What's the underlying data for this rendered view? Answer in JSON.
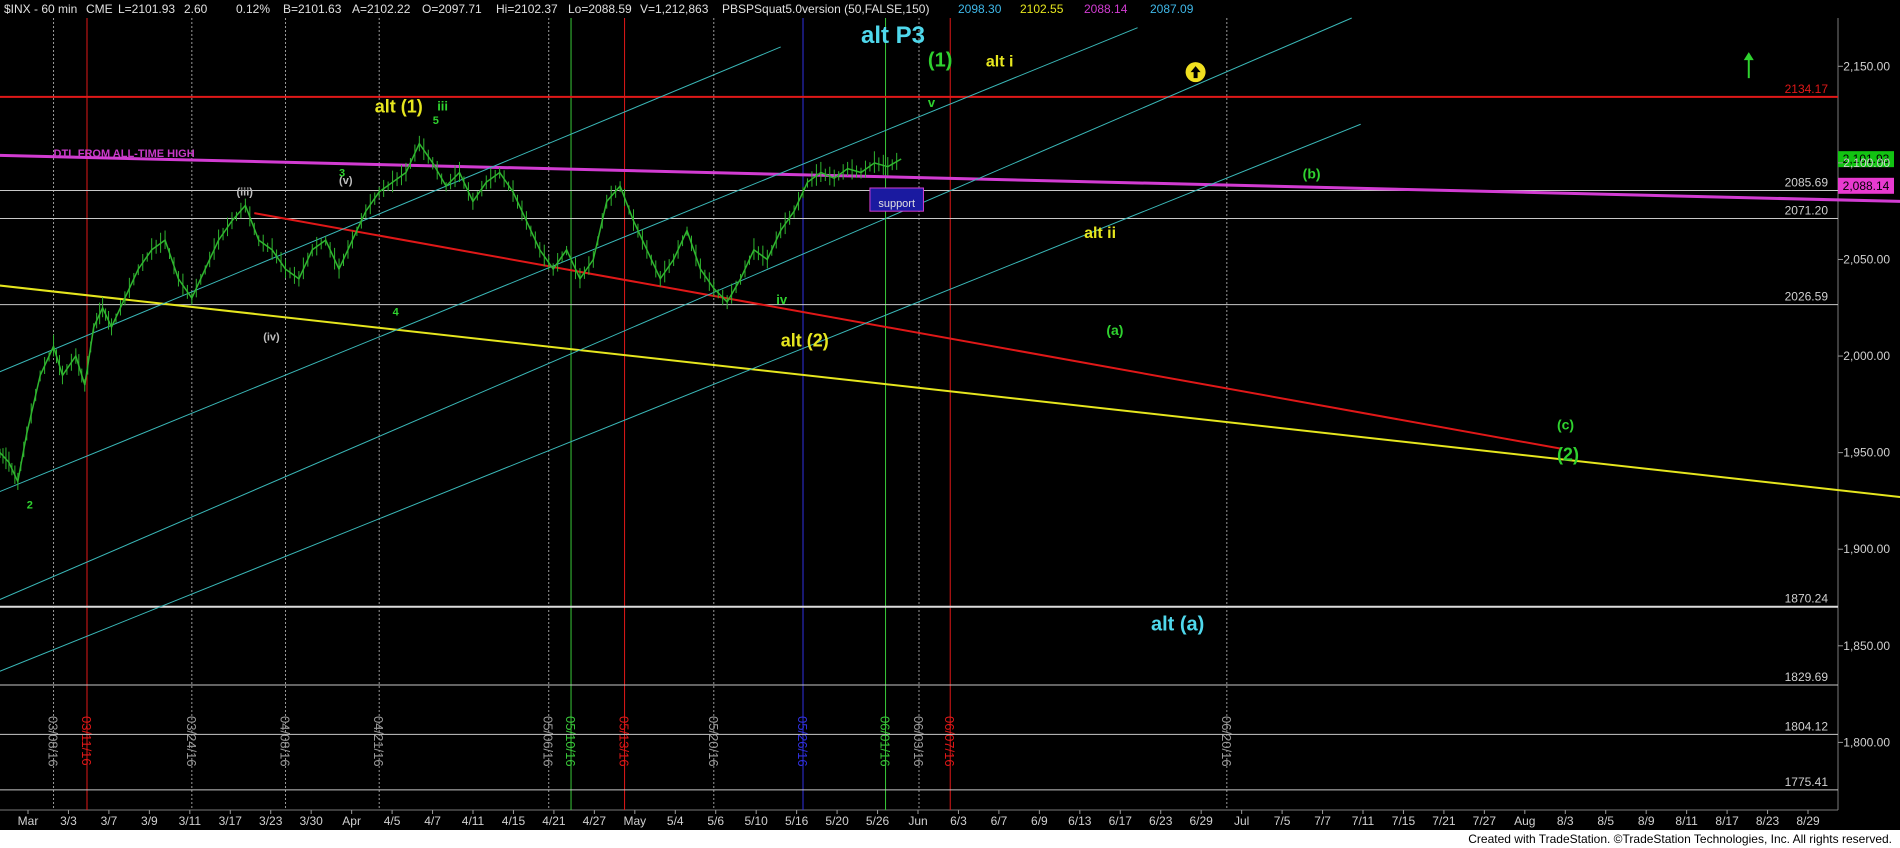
{
  "header": {
    "symbol": "$INX - 60 min",
    "exchange": "CME",
    "last": "L=2101.93",
    "change": "2.60",
    "pct": "0.12%",
    "bid": "B=2101.63",
    "ask": "A=2102.22",
    "open": "O=2097.71",
    "high": "Hi=2102.37",
    "low": "Lo=2088.59",
    "volume": "V=1,212,863",
    "indicator": "PBSPSquat5.0version (50,FALSE,150)",
    "ind_val1": "2098.30",
    "ind_val2": "2102.55",
    "ind_val3": "2088.14",
    "ind_val4": "2087.09"
  },
  "footer": {
    "credit": "Created with TradeStation. ©TradeStation Technologies, Inc. All rights reserved."
  },
  "chart_data": {
    "type": "line",
    "title": "",
    "ylim": [
      1765,
      2175
    ],
    "y_ticks": [
      "2,150.00",
      "2,100.00",
      "2,050.00",
      "2,000.00",
      "1,950.00",
      "1,900.00",
      "1,850.00",
      "1,800.00"
    ],
    "x_ticks": [
      "Mar",
      "3/3",
      "3/7",
      "3/9",
      "3/11",
      "3/17",
      "3/23",
      "3/30",
      "Apr",
      "4/5",
      "4/7",
      "4/11",
      "4/15",
      "4/21",
      "4/27",
      "May",
      "5/4",
      "5/6",
      "5/10",
      "5/16",
      "5/20",
      "5/26",
      "Jun",
      "6/3",
      "6/7",
      "6/9",
      "6/13",
      "6/17",
      "6/23",
      "6/29",
      "Jul",
      "7/5",
      "7/7",
      "7/11",
      "7/15",
      "7/21",
      "7/27",
      "Aug",
      "8/3",
      "8/5",
      "8/9",
      "8/11",
      "8/17",
      "8/23",
      "8/29"
    ],
    "price_series": [
      {
        "t": 0,
        "v": 1950
      },
      {
        "t": 2,
        "v": 1945
      },
      {
        "t": 4,
        "v": 1935
      },
      {
        "t": 6,
        "v": 1960
      },
      {
        "t": 9,
        "v": 1990
      },
      {
        "t": 12,
        "v": 2005
      },
      {
        "t": 14,
        "v": 1990
      },
      {
        "t": 17,
        "v": 2000
      },
      {
        "t": 19,
        "v": 1985
      },
      {
        "t": 21,
        "v": 2015
      },
      {
        "t": 23,
        "v": 2025
      },
      {
        "t": 25,
        "v": 2015
      },
      {
        "t": 28,
        "v": 2030
      },
      {
        "t": 31,
        "v": 2045
      },
      {
        "t": 34,
        "v": 2055
      },
      {
        "t": 37,
        "v": 2060
      },
      {
        "t": 40,
        "v": 2040
      },
      {
        "t": 43,
        "v": 2030
      },
      {
        "t": 46,
        "v": 2045
      },
      {
        "t": 49,
        "v": 2060
      },
      {
        "t": 52,
        "v": 2070
      },
      {
        "t": 55,
        "v": 2078
      },
      {
        "t": 58,
        "v": 2060
      },
      {
        "t": 61,
        "v": 2055
      },
      {
        "t": 64,
        "v": 2045
      },
      {
        "t": 67,
        "v": 2040
      },
      {
        "t": 70,
        "v": 2055
      },
      {
        "t": 73,
        "v": 2060
      },
      {
        "t": 76,
        "v": 2045
      },
      {
        "t": 79,
        "v": 2060
      },
      {
        "t": 82,
        "v": 2075
      },
      {
        "t": 85,
        "v": 2085
      },
      {
        "t": 88,
        "v": 2090
      },
      {
        "t": 91,
        "v": 2095
      },
      {
        "t": 94,
        "v": 2110
      },
      {
        "t": 97,
        "v": 2100
      },
      {
        "t": 100,
        "v": 2088
      },
      {
        "t": 103,
        "v": 2095
      },
      {
        "t": 106,
        "v": 2080
      },
      {
        "t": 109,
        "v": 2090
      },
      {
        "t": 112,
        "v": 2095
      },
      {
        "t": 115,
        "v": 2085
      },
      {
        "t": 118,
        "v": 2070
      },
      {
        "t": 121,
        "v": 2055
      },
      {
        "t": 124,
        "v": 2045
      },
      {
        "t": 127,
        "v": 2055
      },
      {
        "t": 130,
        "v": 2040
      },
      {
        "t": 133,
        "v": 2050
      },
      {
        "t": 136,
        "v": 2080
      },
      {
        "t": 139,
        "v": 2088
      },
      {
        "t": 142,
        "v": 2070
      },
      {
        "t": 145,
        "v": 2055
      },
      {
        "t": 148,
        "v": 2040
      },
      {
        "t": 151,
        "v": 2050
      },
      {
        "t": 154,
        "v": 2065
      },
      {
        "t": 157,
        "v": 2045
      },
      {
        "t": 160,
        "v": 2035
      },
      {
        "t": 163,
        "v": 2028
      },
      {
        "t": 166,
        "v": 2040
      },
      {
        "t": 169,
        "v": 2055
      },
      {
        "t": 172,
        "v": 2050
      },
      {
        "t": 175,
        "v": 2065
      },
      {
        "t": 178,
        "v": 2075
      },
      {
        "t": 181,
        "v": 2090
      },
      {
        "t": 184,
        "v": 2095
      },
      {
        "t": 187,
        "v": 2092
      },
      {
        "t": 190,
        "v": 2097
      },
      {
        "t": 193,
        "v": 2095
      },
      {
        "t": 196,
        "v": 2100
      },
      {
        "t": 199,
        "v": 2098
      },
      {
        "t": 202,
        "v": 2102
      }
    ],
    "price_color": "#2fb52f",
    "horizontal_levels": [
      {
        "v": 2134.17,
        "label": "2134.17",
        "color": "#e01818",
        "width": 2
      },
      {
        "v": 2085.69,
        "label": "2085.69",
        "color": "#c8c8c8",
        "width": 1
      },
      {
        "v": 2071.2,
        "label": "2071.20",
        "color": "#c8c8c8",
        "width": 1
      },
      {
        "v": 2026.59,
        "label": "2026.59",
        "color": "#c8c8c8",
        "width": 1
      },
      {
        "v": 1870.24,
        "label": "1870.24",
        "color": "#dcdcdc",
        "width": 2
      },
      {
        "v": 1829.69,
        "label": "1829.69",
        "color": "#c8c8c8",
        "width": 1
      },
      {
        "v": 1804.12,
        "label": "1804.12",
        "color": "#c8c8c8",
        "width": 1
      },
      {
        "v": 1775.41,
        "label": "1775.41",
        "color": "#c8c8c8",
        "width": 1
      }
    ],
    "price_flags": [
      {
        "v": 2101.93,
        "label": "2,101.93",
        "color": "#12c412"
      },
      {
        "v": 2088.14,
        "label": "2,088.14",
        "color": "#e83ad0"
      }
    ],
    "trend_lines": [
      {
        "name": "dtl",
        "color": "#d23cd2",
        "width": 3,
        "p1": [
          -2,
          2104
        ],
        "p2": [
          570,
          2072
        ]
      },
      {
        "name": "red",
        "color": "#e01818",
        "width": 2,
        "p1": [
          57,
          2074
        ],
        "p2": [
          350,
          1952
        ]
      },
      {
        "name": "yellow",
        "color": "#e6e61e",
        "width": 2,
        "p1": [
          -2,
          2037
        ],
        "p2": [
          430,
          1926
        ]
      },
      {
        "name": "ch1",
        "color": "#3ab8b8",
        "width": 1,
        "p1": [
          -2,
          1990
        ],
        "p2": [
          175,
          2160
        ]
      },
      {
        "name": "ch2",
        "color": "#3ab8b8",
        "width": 1,
        "p1": [
          -2,
          1928
        ],
        "p2": [
          255,
          2170
        ]
      },
      {
        "name": "ch3",
        "color": "#3ab8b8",
        "width": 1,
        "p1": [
          -2,
          1872
        ],
        "p2": [
          303,
          2175
        ]
      },
      {
        "name": "ch4",
        "color": "#3ab8b8",
        "width": 1,
        "p1": [
          -2,
          1835
        ],
        "p2": [
          305,
          2120
        ]
      }
    ],
    "vertical_markers": [
      {
        "t": 12,
        "label": "03/08/16",
        "color": "#9a9a9a"
      },
      {
        "t": 19.5,
        "label": "03/11/16",
        "color": "#e01818"
      },
      {
        "t": 43,
        "label": "03/24/16",
        "color": "#9a9a9a"
      },
      {
        "t": 64,
        "label": "04/08/16",
        "color": "#9a9a9a"
      },
      {
        "t": 85,
        "label": "04/21/16",
        "color": "#9a9a9a"
      },
      {
        "t": 123,
        "label": "05/06/16",
        "color": "#9a9a9a"
      },
      {
        "t": 128,
        "label": "05/10/16",
        "color": "#39c839"
      },
      {
        "t": 140,
        "label": "05/13/16",
        "color": "#e01818"
      },
      {
        "t": 160,
        "label": "05/20/16",
        "color": "#9a9a9a"
      },
      {
        "t": 180,
        "label": "05/26/16",
        "color": "#3030e0"
      },
      {
        "t": 198.5,
        "label": "06/01/16",
        "color": "#39c839"
      },
      {
        "t": 206,
        "label": "06/03/16",
        "color": "#9a9a9a"
      },
      {
        "t": 213,
        "label": "06/07/16",
        "color": "#e01818"
      },
      {
        "t": 275,
        "label": "06/20/16",
        "color": "#9a9a9a"
      }
    ],
    "annotations": [
      {
        "text": "alt P3",
        "t": 193,
        "v": 2162,
        "color": "#4fd8ec",
        "size": 24
      },
      {
        "text": "(1)",
        "t": 208,
        "v": 2150,
        "color": "#2fd22f",
        "size": 20
      },
      {
        "text": "alt i",
        "t": 221,
        "v": 2150,
        "color": "#e6e61e",
        "size": 16
      },
      {
        "text": "v",
        "t": 208,
        "v": 2129,
        "color": "#2fd22f",
        "size": 13
      },
      {
        "text": "alt (1)",
        "t": 84,
        "v": 2126,
        "color": "#e6e61e",
        "size": 18
      },
      {
        "text": "iii",
        "t": 98,
        "v": 2127,
        "color": "#2fd22f",
        "size": 13
      },
      {
        "text": "5",
        "t": 97,
        "v": 2120,
        "color": "#2fd22f",
        "size": 11
      },
      {
        "text": "DTL FROM ALL-TIME HIGH",
        "t": 12,
        "v": 2103,
        "color": "#c83ac8",
        "size": 11
      },
      {
        "text": "(b)",
        "t": 292,
        "v": 2092,
        "color": "#2fd22f",
        "size": 14
      },
      {
        "text": "alt ii",
        "t": 243,
        "v": 2061,
        "color": "#e6e61e",
        "size": 16
      },
      {
        "text": "(a)",
        "t": 248,
        "v": 2011,
        "color": "#2fd22f",
        "size": 14
      },
      {
        "text": "iv",
        "t": 174,
        "v": 2027,
        "color": "#2fd22f",
        "size": 13
      },
      {
        "text": "alt (2)",
        "t": 175,
        "v": 2005,
        "color": "#e6e61e",
        "size": 18
      },
      {
        "text": "(c)",
        "t": 349,
        "v": 1962,
        "color": "#2fd22f",
        "size": 14
      },
      {
        "text": "(2)",
        "t": 349,
        "v": 1946,
        "color": "#2fd22f",
        "size": 18
      },
      {
        "text": "alt (a)",
        "t": 258,
        "v": 1858,
        "color": "#4fd8ec",
        "size": 20
      },
      {
        "text": "(iii)",
        "t": 53,
        "v": 2083,
        "color": "#bfbfbf",
        "size": 11
      },
      {
        "text": "(v)",
        "t": 76,
        "v": 2089,
        "color": "#bfbfbf",
        "size": 11
      },
      {
        "text": "3",
        "t": 76,
        "v": 2093,
        "color": "#2fd22f",
        "size": 11
      },
      {
        "text": "(iv)",
        "t": 59,
        "v": 2008,
        "color": "#bfbfbf",
        "size": 11
      },
      {
        "text": "4",
        "t": 88,
        "v": 2021,
        "color": "#2fd22f",
        "size": 11
      },
      {
        "text": "2",
        "t": 6,
        "v": 1921,
        "color": "#2fd22f",
        "size": 11
      }
    ],
    "support_box": {
      "label": "support",
      "t1": 195,
      "t2": 207,
      "v1": 2075,
      "v2": 2087
    },
    "circle_marker": {
      "t": 268,
      "v": 2147,
      "color": "#f0e020"
    },
    "up_arrow": {
      "t": 392,
      "v": 2148,
      "color": "#2fd22f"
    }
  }
}
